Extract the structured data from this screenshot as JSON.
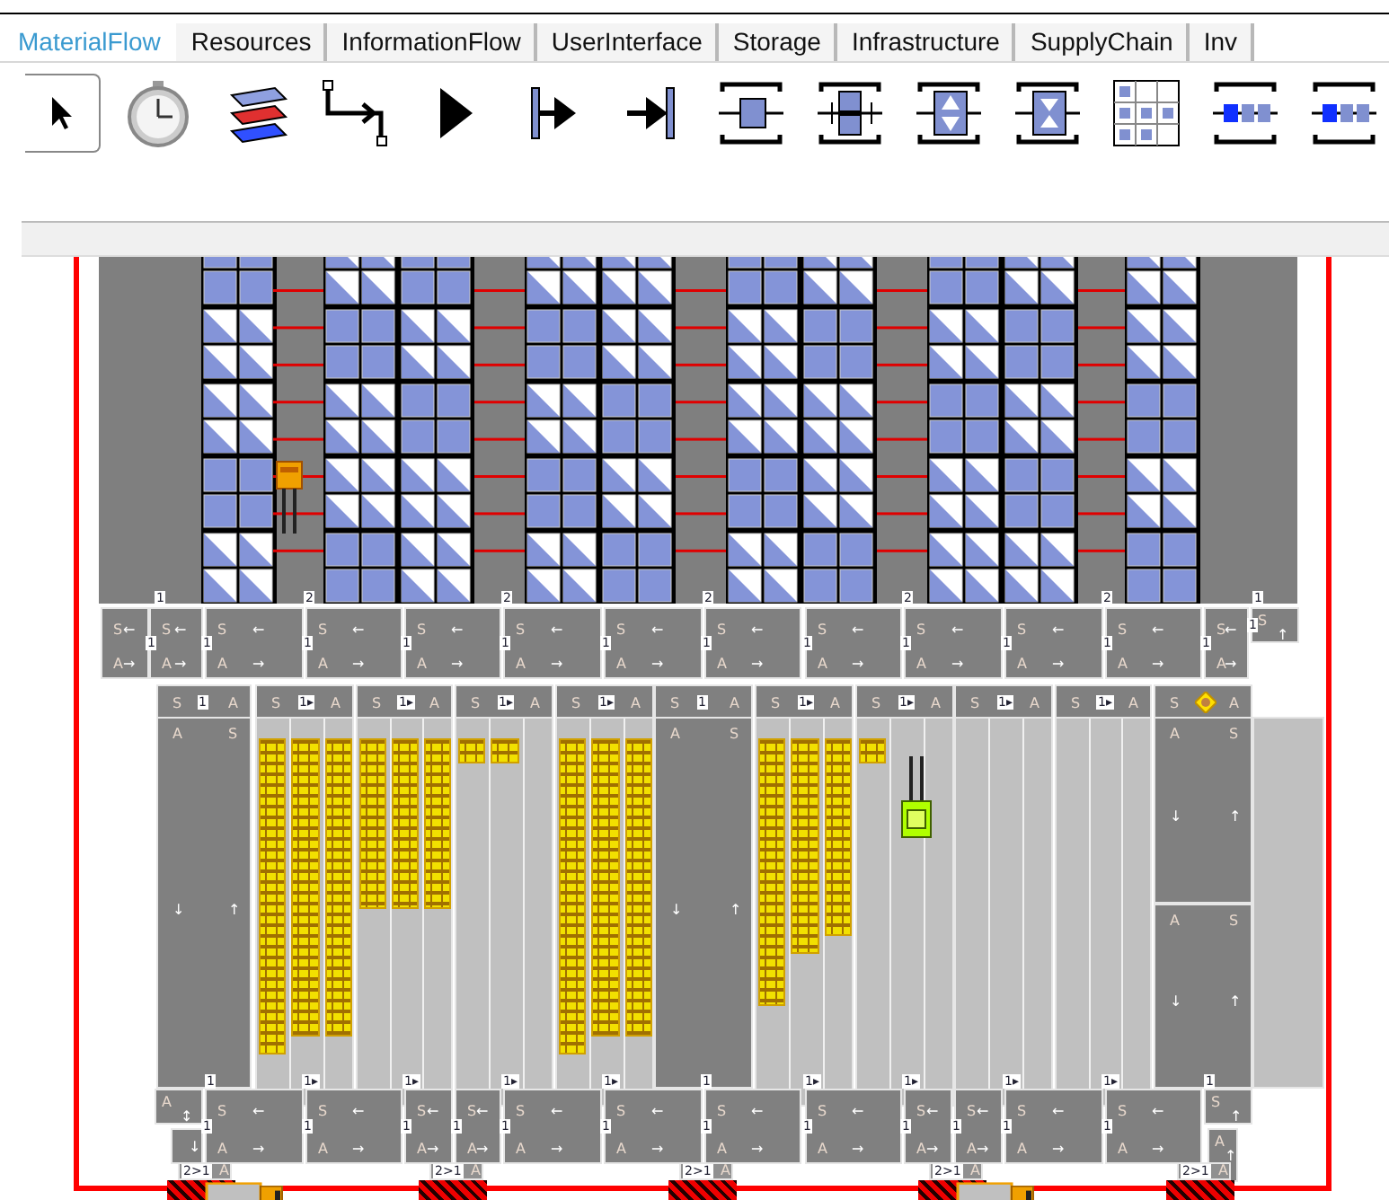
{
  "tabs": [
    {
      "label": "MaterialFlow",
      "selected": true
    },
    {
      "label": "Resources",
      "selected": false
    },
    {
      "label": "InformationFlow",
      "selected": false
    },
    {
      "label": "UserInterface",
      "selected": false
    },
    {
      "label": "Storage",
      "selected": false
    },
    {
      "label": "Infrastructure",
      "selected": false
    },
    {
      "label": "SupplyChain",
      "selected": false
    },
    {
      "label": "Inv",
      "selected": false
    }
  ],
  "toolbar": [
    {
      "kind": "pointer",
      "selected": true
    },
    {
      "kind": "stopwatch",
      "selected": false
    },
    {
      "kind": "layers",
      "selected": false
    },
    {
      "kind": "connector",
      "selected": false
    },
    {
      "kind": "play",
      "selected": false
    },
    {
      "kind": "source",
      "selected": false
    },
    {
      "kind": "drain",
      "selected": false
    },
    {
      "kind": "station",
      "selected": false
    },
    {
      "kind": "parallel",
      "selected": false
    },
    {
      "kind": "assembly",
      "selected": false
    },
    {
      "kind": "disassembly",
      "selected": false
    },
    {
      "kind": "store",
      "selected": false
    },
    {
      "kind": "line",
      "selected": false
    },
    {
      "kind": "line",
      "selected": false
    }
  ],
  "canvas": {
    "rack_ports": [
      "1",
      "2",
      "2",
      "2",
      "2",
      "2",
      "1"
    ],
    "upper_transfers": [
      {
        "kind": "full",
        "top": "S",
        "top_arrow": "←",
        "bottom": "A",
        "bottom_arrow": "→"
      },
      {
        "kind": "full",
        "top": "S",
        "top_arrow": "←",
        "bottom": "A",
        "bottom_arrow": "→",
        "port": "1"
      },
      {
        "kind": "full",
        "top": "S",
        "top_arrow": "←",
        "bottom": "A",
        "bottom_arrow": "→",
        "port": "1"
      },
      {
        "kind": "full",
        "top": "S",
        "top_arrow": "←",
        "bottom": "A",
        "bottom_arrow": "→",
        "port": "1"
      },
      {
        "kind": "full",
        "top": "S",
        "top_arrow": "←",
        "bottom": "A",
        "bottom_arrow": "→",
        "port": "1"
      },
      {
        "kind": "full",
        "top": "S",
        "top_arrow": "←",
        "bottom": "A",
        "bottom_arrow": "→",
        "port": "1"
      },
      {
        "kind": "full",
        "top": "S",
        "top_arrow": "←",
        "bottom": "A",
        "bottom_arrow": "→",
        "port": "1"
      },
      {
        "kind": "full",
        "top": "S",
        "top_arrow": "←",
        "bottom": "A",
        "bottom_arrow": "→",
        "port": "1"
      },
      {
        "kind": "full",
        "top": "S",
        "top_arrow": "←",
        "bottom": "A",
        "bottom_arrow": "→",
        "port": "1"
      },
      {
        "kind": "full",
        "top": "S",
        "top_arrow": "←",
        "bottom": "A",
        "bottom_arrow": "→",
        "port": "1"
      },
      {
        "kind": "full",
        "top": "S",
        "top_arrow": "←",
        "bottom": "A",
        "bottom_arrow": "→",
        "port": "1"
      },
      {
        "kind": "full",
        "top": "S",
        "top_arrow": "←",
        "bottom": "A",
        "bottom_arrow": "→",
        "port": "1"
      },
      {
        "kind": "full",
        "top": "S",
        "top_arrow": "←",
        "bottom": "A",
        "bottom_arrow": "→",
        "port": "1"
      },
      {
        "kind": "stub",
        "top": "S",
        "top_arrow": "↑",
        "port": "1"
      }
    ],
    "lane_headers": [
      {
        "left": "S",
        "port": "1",
        "right": "A"
      },
      {
        "left": "S",
        "port": "1▸",
        "right": "A"
      },
      {
        "left": "S",
        "port": "1▸",
        "right": "A"
      },
      {
        "left": "S",
        "port": "1▸",
        "right": "A"
      },
      {
        "left": "S",
        "port": "1▸",
        "right": "A"
      },
      {
        "left": "S",
        "port": "1",
        "right": "A"
      },
      {
        "left": "S",
        "port": "1▸",
        "right": "A"
      },
      {
        "left": "S",
        "port": "1▸",
        "right": "A"
      },
      {
        "left": "S",
        "port": "1▸",
        "right": "A"
      },
      {
        "left": "S",
        "port": "1▸",
        "right": "A"
      },
      {
        "left": "S",
        "right": "A",
        "sensor": true
      }
    ],
    "lanes": [
      {
        "kind": "transfer",
        "sections": [
          {
            "left": "A",
            "right": "S",
            "down": "↓",
            "up": "↑"
          }
        ]
      },
      {
        "kind": "buffer"
      },
      {
        "kind": "buffer"
      },
      {
        "kind": "buffer"
      },
      {
        "kind": "buffer"
      },
      {
        "kind": "transfer",
        "sections": [
          {
            "left": "A",
            "right": "S",
            "down": "↓",
            "up": "↑"
          }
        ]
      },
      {
        "kind": "buffer"
      },
      {
        "kind": "buffer",
        "forklift": true
      },
      {
        "kind": "buffer"
      },
      {
        "kind": "buffer"
      },
      {
        "kind": "transfer",
        "sections": [
          {
            "left": "A",
            "right": "S",
            "down": "↓",
            "up": "↑"
          },
          {
            "left": "A",
            "right": "S",
            "down": "↓",
            "up": "↑"
          }
        ]
      }
    ],
    "lower_ports": [
      "1",
      "1▸",
      "1▸",
      "1▸",
      "1▸",
      "1",
      "1▸",
      "1▸",
      "1▸",
      "1▸",
      "1"
    ],
    "lower_transfers": [
      {
        "kind": "stub",
        "top": "A",
        "top_arrow": "↕"
      },
      {
        "kind": "stub",
        "top_arrow": "↓"
      },
      {
        "kind": "full",
        "top": "S",
        "top_arrow": "←",
        "bottom": "A",
        "bottom_arrow": "→",
        "port": "1"
      },
      {
        "kind": "full",
        "top": "S",
        "top_arrow": "←",
        "bottom": "A",
        "bottom_arrow": "→",
        "port": "1"
      },
      {
        "kind": "full",
        "top": "S",
        "top_arrow": "←",
        "bottom": "A",
        "bottom_arrow": "→",
        "port": "1"
      },
      {
        "kind": "full",
        "top": "S",
        "top_arrow": "←",
        "bottom": "A",
        "bottom_arrow": "→",
        "port": "1"
      },
      {
        "kind": "full",
        "top": "S",
        "top_arrow": "←",
        "bottom": "A",
        "bottom_arrow": "→",
        "port": "1"
      },
      {
        "kind": "full",
        "top": "S",
        "top_arrow": "←",
        "bottom": "A",
        "bottom_arrow": "→",
        "port": "1"
      },
      {
        "kind": "full",
        "top": "S",
        "top_arrow": "←",
        "bottom": "A",
        "bottom_arrow": "→",
        "port": "1"
      },
      {
        "kind": "full",
        "top": "S",
        "top_arrow": "←",
        "bottom": "A",
        "bottom_arrow": "→",
        "port": "1"
      },
      {
        "kind": "full",
        "top": "S",
        "top_arrow": "←",
        "bottom": "A",
        "bottom_arrow": "→",
        "port": "1"
      },
      {
        "kind": "full",
        "top": "S",
        "top_arrow": "←",
        "bottom": "A",
        "bottom_arrow": "→",
        "port": "1"
      },
      {
        "kind": "full",
        "top": "S",
        "top_arrow": "←",
        "bottom": "A",
        "bottom_arrow": "→",
        "port": "1"
      },
      {
        "kind": "full",
        "top": "S",
        "top_arrow": "←",
        "bottom": "A",
        "bottom_arrow": "→",
        "port": "1"
      },
      {
        "kind": "stub",
        "top": "S",
        "top_arrow": "↑"
      },
      {
        "kind": "stub",
        "top_arrow": "↑",
        "top": "A"
      }
    ],
    "docks": [
      {
        "label": "2>1",
        "side": "A",
        "truck": true
      },
      {
        "label": "2>1",
        "side": "A",
        "truck": false
      },
      {
        "label": "2>1",
        "side": "A",
        "truck": false
      },
      {
        "label": "2>1",
        "side": "A",
        "truck": true
      },
      {
        "label": "2>1",
        "side": "A",
        "truck": false
      }
    ]
  }
}
